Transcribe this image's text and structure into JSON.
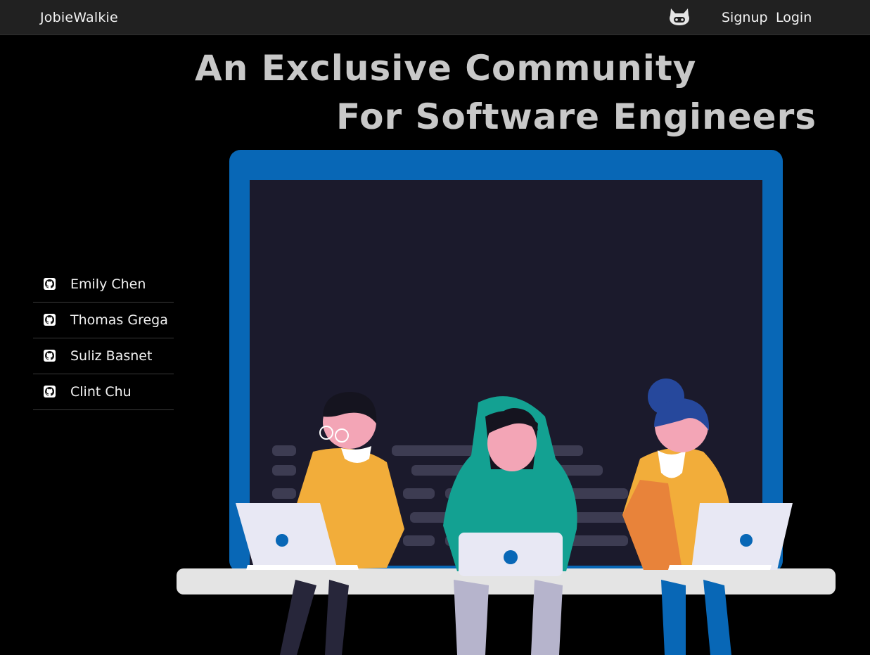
{
  "navbar": {
    "brand": "JobieWalkie",
    "github_icon": "github-octocat-icon",
    "signup_label": "Signup",
    "login_label": "Login"
  },
  "hero": {
    "line1": "An Exclusive Community",
    "line2": "For Software Engineers",
    "illustration": "three-developers-with-laptops-illustration"
  },
  "developers": [
    {
      "name": "Emily Chen",
      "icon": "github-icon"
    },
    {
      "name": "Thomas Grega",
      "icon": "github-icon"
    },
    {
      "name": "Suliz Basnet",
      "icon": "github-icon"
    },
    {
      "name": "Clint Chu",
      "icon": "github-icon"
    }
  ],
  "colors": {
    "navbar_bg": "#212121",
    "page_bg": "#000000",
    "headline": "#c8c8c8",
    "screen_frame": "#0867b6",
    "screen_bg": "#1b1a2c"
  }
}
